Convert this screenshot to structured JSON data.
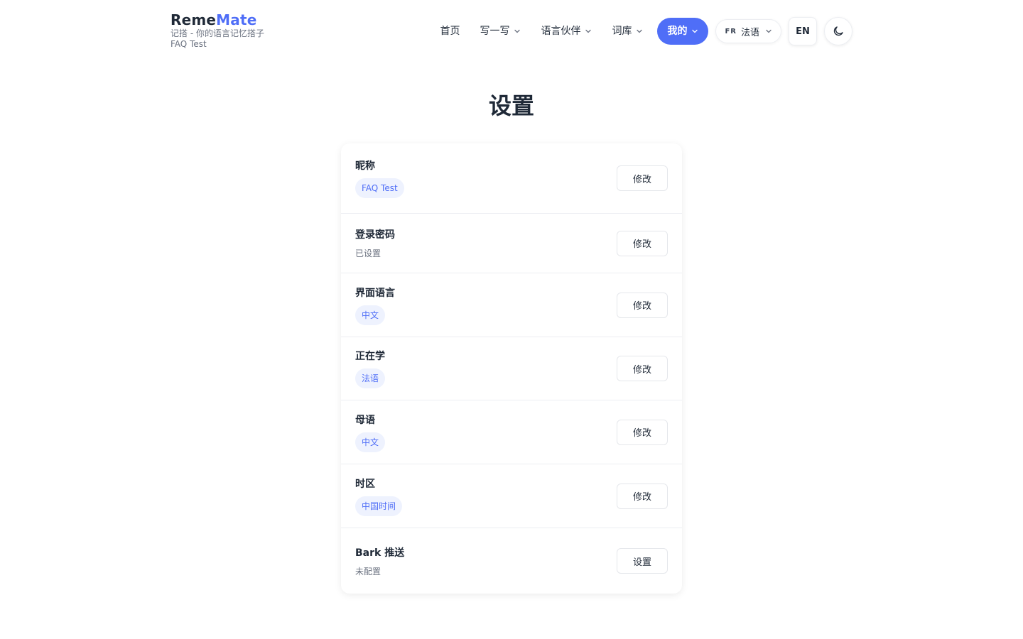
{
  "brand": {
    "name_part1": "Reme",
    "name_part2": "Mate",
    "tagline": "记搭 - 你的语言记忆搭子",
    "username": "FAQ Test"
  },
  "nav": {
    "home": "首页",
    "write": "写一写",
    "partner": "语言伙伴",
    "vocab": "词库",
    "mine": "我的",
    "language_code": "FR",
    "language_name": "法语",
    "ui_toggle": "EN",
    "theme_icon": "moon-icon"
  },
  "page": {
    "title": "设置"
  },
  "settings": {
    "rows": [
      {
        "label": "昵称",
        "value": "FAQ Test",
        "value_style": "chip",
        "action": "修改"
      },
      {
        "label": "登录密码",
        "value": "已设置",
        "value_style": "muted",
        "action": "修改"
      },
      {
        "label": "界面语言",
        "value": "中文",
        "value_style": "chip",
        "action": "修改"
      },
      {
        "label": "正在学",
        "value": "法语",
        "value_style": "chip",
        "action": "修改"
      },
      {
        "label": "母语",
        "value": "中文",
        "value_style": "chip",
        "action": "修改"
      },
      {
        "label": "时区",
        "value": "中国时间",
        "value_style": "chip",
        "action": "修改"
      },
      {
        "label": "Bark 推送",
        "value": "未配置",
        "value_style": "muted",
        "action": "设置"
      }
    ]
  },
  "colors": {
    "accent": "#4f6ef7",
    "chip_bg": "#eef2fe",
    "text": "#1f2937",
    "muted": "#6b7280",
    "border": "#eceef2"
  }
}
